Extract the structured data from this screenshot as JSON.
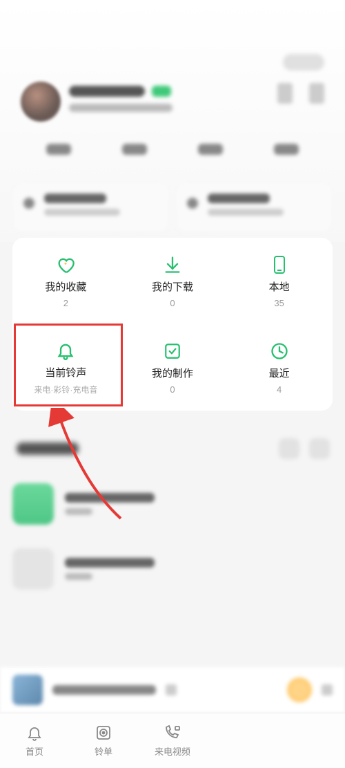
{
  "grid": [
    {
      "key": "favorites",
      "label": "我的收藏",
      "count": "2"
    },
    {
      "key": "downloads",
      "label": "我的下载",
      "count": "0"
    },
    {
      "key": "local",
      "label": "本地",
      "count": "35"
    },
    {
      "key": "current-ringtone",
      "label": "当前铃声",
      "sub": "来电·彩铃·充电音"
    },
    {
      "key": "my-creations",
      "label": "我的制作",
      "count": "0"
    },
    {
      "key": "recent",
      "label": "最近",
      "count": "4"
    }
  ],
  "tabs": [
    {
      "key": "home",
      "label": "首页"
    },
    {
      "key": "playlist",
      "label": "铃单"
    },
    {
      "key": "callvideo",
      "label": "来电视频"
    }
  ],
  "colors": {
    "accent": "#26bf6e",
    "highlight": "#e53935"
  }
}
